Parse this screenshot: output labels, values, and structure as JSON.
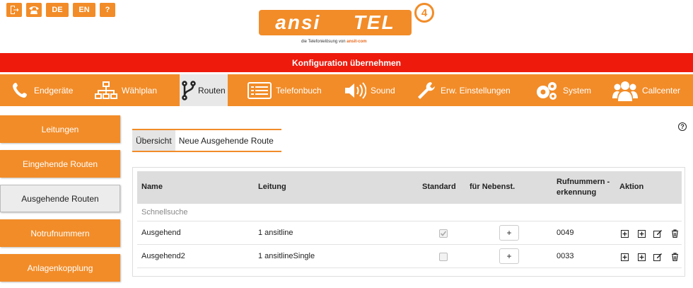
{
  "header": {
    "lang_de": "DE",
    "lang_en": "EN",
    "help": "?",
    "logo_left": "ansi",
    "logo_right": "TEL",
    "logo_version": "4",
    "logo_tagline": "die Telefonielösung von",
    "logo_brand": "ansit-com"
  },
  "apply_bar": {
    "label": "Konfiguration übernehmen",
    "color": "#ee1b0d"
  },
  "nav": {
    "accent": "#f28c28",
    "items": [
      {
        "label": "Endgeräte",
        "icon": "phone-icon"
      },
      {
        "label": "Wählplan",
        "icon": "sitemap-icon"
      },
      {
        "label": "Routen",
        "icon": "fork-icon",
        "active": true
      },
      {
        "label": "Telefonbuch",
        "icon": "list-icon"
      },
      {
        "label": "Sound",
        "icon": "speaker-icon"
      },
      {
        "label": "Erw. Einstellungen",
        "icon": "wrench-icon"
      },
      {
        "label": "System",
        "icon": "gears-icon"
      },
      {
        "label": "Callcenter",
        "icon": "users-icon"
      }
    ]
  },
  "sidebar": {
    "items": [
      {
        "label": "Leitungen"
      },
      {
        "label": "Eingehende Routen"
      },
      {
        "label": "Ausgehende Routen",
        "active": true
      },
      {
        "label": "Notrufnummern"
      },
      {
        "label": "Anlagenkopplung"
      }
    ]
  },
  "tabs": [
    {
      "label": "Übersicht",
      "active": true
    },
    {
      "label": "Neue Ausgehende Route"
    }
  ],
  "table": {
    "columns": {
      "name": "Name",
      "leitung": "Leitung",
      "standard": "Standard",
      "nebenst": "für Nebenst.",
      "rufnummer": "Rufnummern -erkennung",
      "aktion": "Aktion"
    },
    "quicksearch": "Schnellsuche",
    "rows": [
      {
        "name": "Ausgehend",
        "leitung": "1 ansitline",
        "standard": true,
        "button": "+",
        "rufnummer": "0049"
      },
      {
        "name": "Ausgehend2",
        "leitung": "1 ansitlineSingle",
        "standard": false,
        "button": "+",
        "rufnummer": "0033"
      }
    ]
  }
}
